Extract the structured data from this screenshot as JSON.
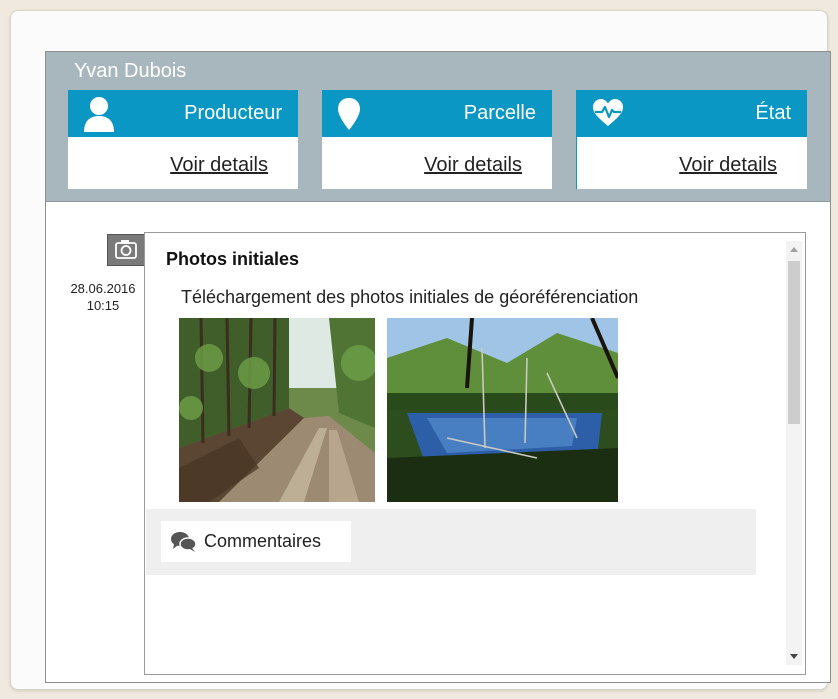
{
  "header": {
    "user_name": "Yvan Dubois",
    "tiles": [
      {
        "title": "Producteur",
        "link": "Voir details",
        "icon": "user-icon"
      },
      {
        "title": "Parcelle",
        "link": "Voir details",
        "icon": "map-pin-icon"
      },
      {
        "title": "État",
        "link": "Voir details",
        "icon": "heartbeat-icon"
      }
    ]
  },
  "entry": {
    "icon": "camera-icon",
    "date": "28.06.2016",
    "time": "10:15",
    "title": "Photos initiales",
    "description": "Téléchargement des photos initiales de géoréférenciation",
    "comments_label": "Commentaires"
  },
  "colors": {
    "accent": "#0b97c3",
    "header_bg": "#a8b7bd"
  }
}
